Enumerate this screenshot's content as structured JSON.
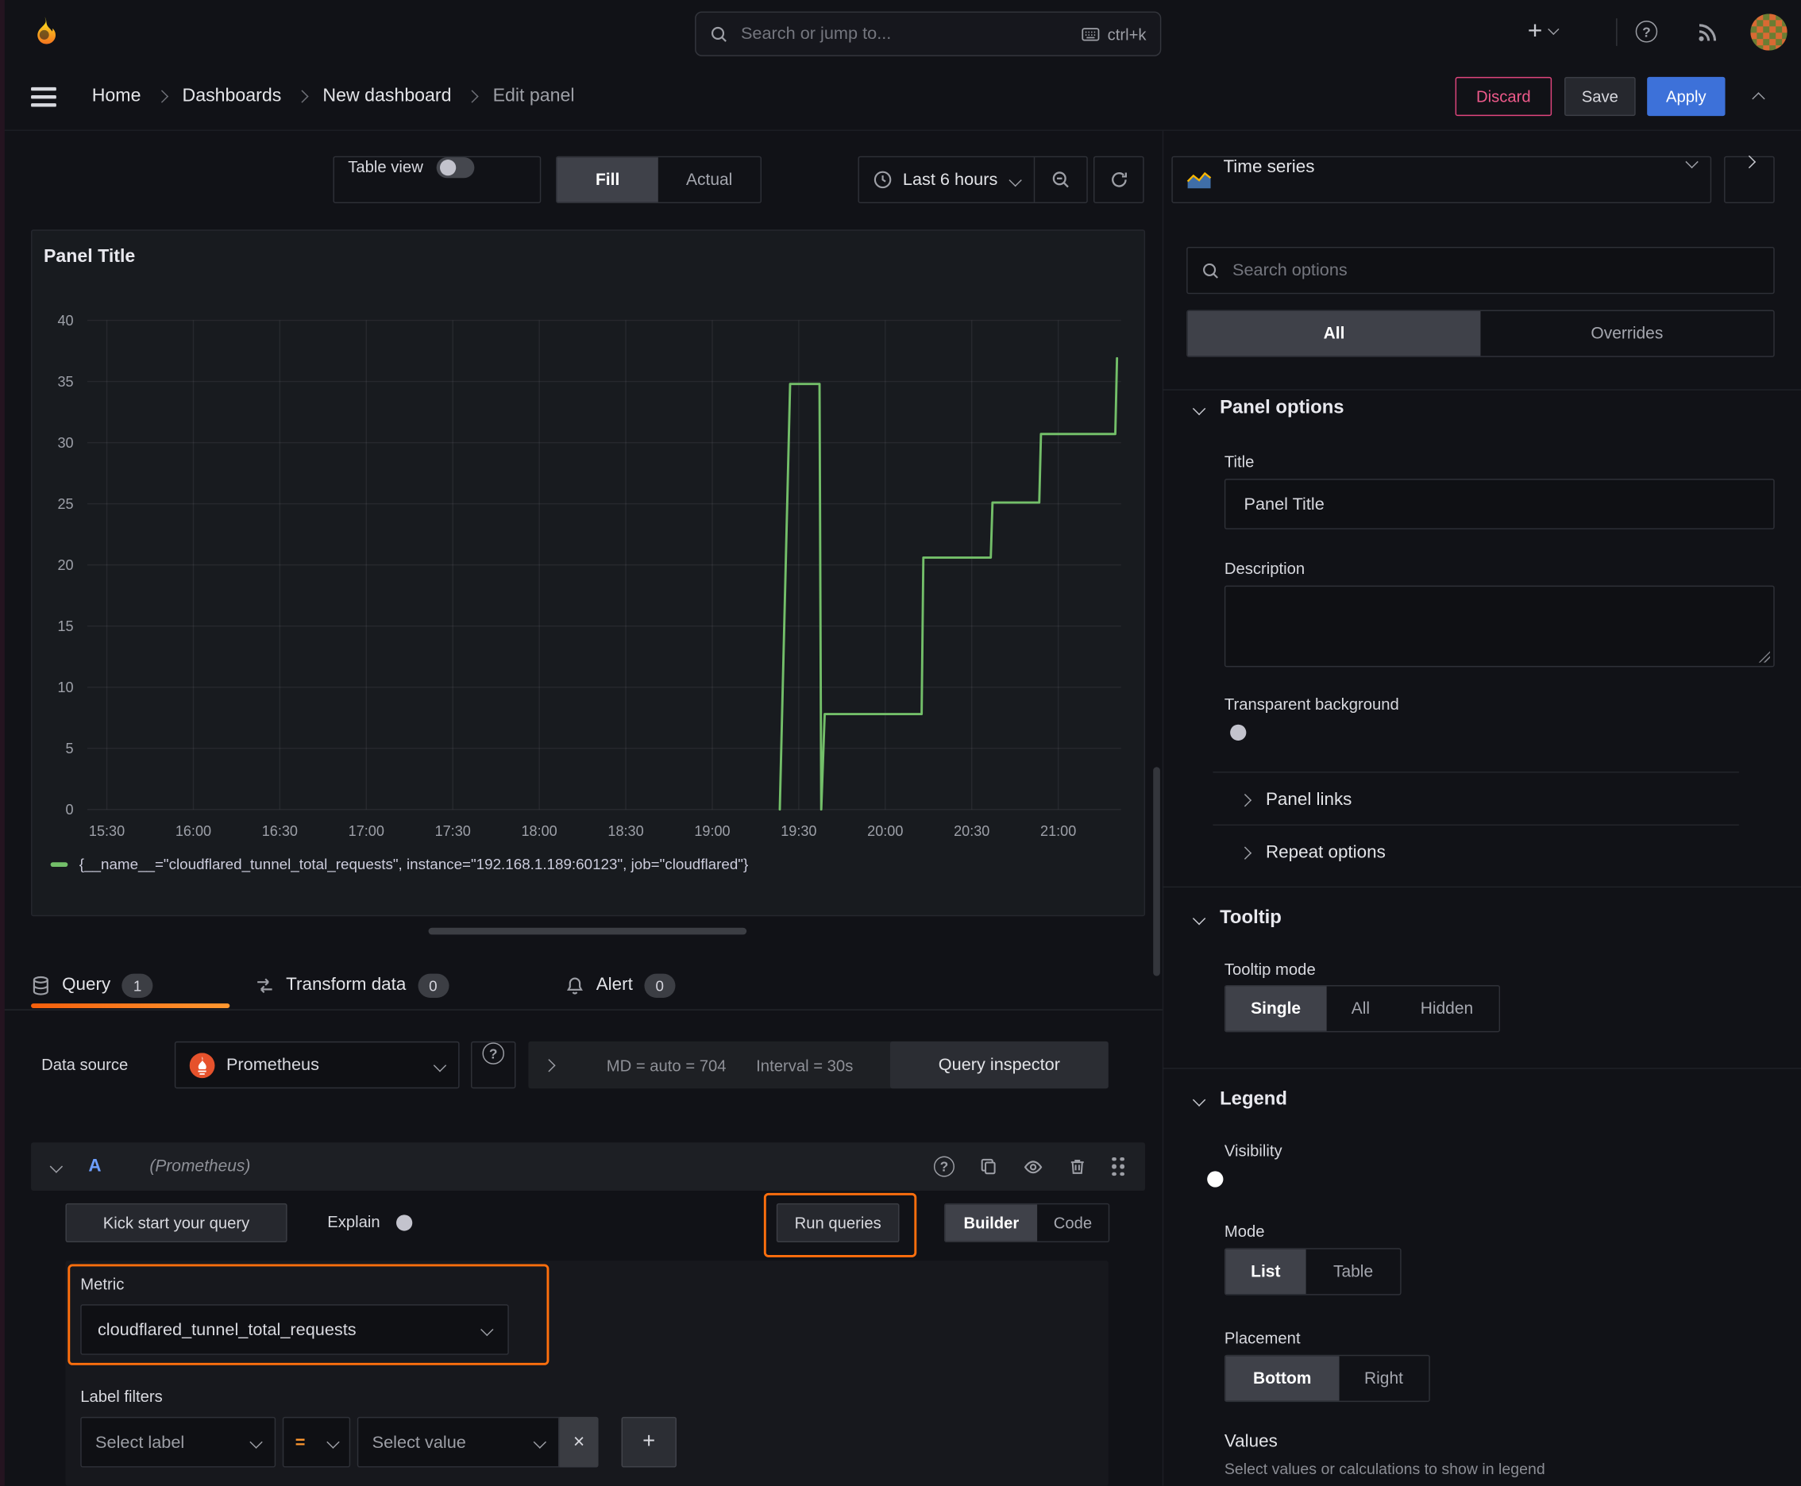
{
  "topnav": {
    "search_placeholder": "Search or jump to...",
    "shortcut": "ctrl+k",
    "plus": "+",
    "help": "?",
    "close": "×"
  },
  "breadcrumb": {
    "items": [
      {
        "label": "Home"
      },
      {
        "label": "Dashboards"
      },
      {
        "label": "New dashboard"
      },
      {
        "label": "Edit panel"
      }
    ],
    "discard": "Discard",
    "save": "Save",
    "apply": "Apply"
  },
  "toolbar": {
    "table_view": "Table view",
    "fill": "Fill",
    "actual": "Actual",
    "time_range": "Last 6 hours"
  },
  "viz_picker": {
    "name": "Time series"
  },
  "options_sidebar": {
    "search_placeholder": "Search options",
    "tab_all": "All",
    "tab_overrides": "Overrides",
    "panel_options": {
      "header": "Panel options",
      "title_label": "Title",
      "title_value": "Panel Title",
      "description_label": "Description",
      "transparent_label": "Transparent background"
    },
    "panel_links": "Panel links",
    "repeat_options": "Repeat options",
    "tooltip": {
      "header": "Tooltip",
      "mode_label": "Tooltip mode",
      "single": "Single",
      "all": "All",
      "hidden": "Hidden"
    },
    "legend": {
      "header": "Legend",
      "visibility_label": "Visibility",
      "mode_label": "Mode",
      "list": "List",
      "table": "Table",
      "placement_label": "Placement",
      "bottom": "Bottom",
      "right": "Right",
      "values_label": "Values",
      "values_help": "Select values or calculations to show in legend"
    }
  },
  "query_section": {
    "tabs": {
      "query": "Query",
      "query_count": "1",
      "transform": "Transform data",
      "transform_count": "0",
      "alert": "Alert",
      "alert_count": "0"
    },
    "datasource_label": "Data source",
    "datasource_name": "Prometheus",
    "stats_md": "MD = auto = 704",
    "stats_interval": "Interval = 30s",
    "inspector": "Query inspector",
    "row": {
      "refid": "A",
      "ds_hint": "(Prometheus)"
    },
    "kickstart": "Kick start your query",
    "explain": "Explain",
    "run": "Run queries",
    "builder": "Builder",
    "code": "Code",
    "metric_label": "Metric",
    "metric_value": "cloudflared_tunnel_total_requests",
    "label_filters_label": "Label filters",
    "select_label": "Select label",
    "operator": "=",
    "select_value": "Select value",
    "remove": "×",
    "add": "+"
  },
  "chart_data": {
    "type": "line",
    "title": "Panel Title",
    "line_color": "#73BF69",
    "grid": true,
    "legend_position": "bottom",
    "ylim": [
      0,
      40
    ],
    "y_ticks": [
      0,
      5,
      10,
      15,
      20,
      25,
      30,
      35,
      40
    ],
    "x_range_hours": [
      15.387,
      21.363
    ],
    "x_ticks": [
      {
        "h": 15.5,
        "label": "15:30"
      },
      {
        "h": 16.0,
        "label": "16:00"
      },
      {
        "h": 16.5,
        "label": "16:30"
      },
      {
        "h": 17.0,
        "label": "17:00"
      },
      {
        "h": 17.5,
        "label": "17:30"
      },
      {
        "h": 18.0,
        "label": "18:00"
      },
      {
        "h": 18.5,
        "label": "18:30"
      },
      {
        "h": 19.0,
        "label": "19:00"
      },
      {
        "h": 19.5,
        "label": "19:30"
      },
      {
        "h": 20.0,
        "label": "20:00"
      },
      {
        "h": 20.5,
        "label": "20:30"
      },
      {
        "h": 21.0,
        "label": "21:00"
      }
    ],
    "series": [
      {
        "name": "{__name__=\"cloudflared_tunnel_total_requests\", instance=\"192.168.1.189:60123\", job=\"cloudflared\"}",
        "points_h_v": [
          [
            19.39,
            0
          ],
          [
            19.45,
            34.8
          ],
          [
            19.62,
            34.8
          ],
          [
            19.63,
            0
          ],
          [
            19.65,
            7.8
          ],
          [
            20.21,
            7.8
          ],
          [
            20.22,
            20.6
          ],
          [
            20.61,
            20.6
          ],
          [
            20.62,
            25.1
          ],
          [
            20.89,
            25.1
          ],
          [
            20.9,
            30.7
          ],
          [
            21.33,
            30.7
          ],
          [
            21.34,
            36.9
          ]
        ]
      }
    ]
  }
}
